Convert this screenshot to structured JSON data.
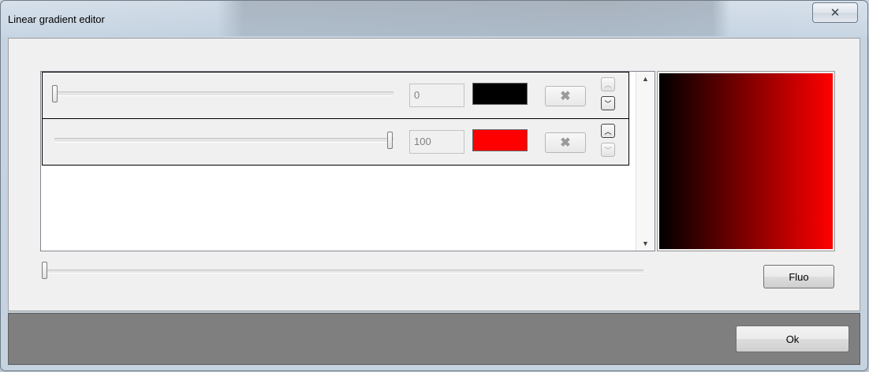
{
  "window": {
    "title": "Linear gradient editor",
    "close_icon": "close-icon"
  },
  "stops": [
    {
      "position": "0",
      "position_fraction": 0.0,
      "color": "#000000",
      "delete_icon": "delete-icon",
      "move_up_enabled": false,
      "move_down_enabled": true
    },
    {
      "position": "100",
      "position_fraction": 1.0,
      "color": "#ff0000",
      "delete_icon": "delete-icon",
      "move_up_enabled": true,
      "move_down_enabled": false
    }
  ],
  "list_scrollbar": {
    "up_icon": "scroll-up-icon",
    "down_icon": "scroll-down-icon"
  },
  "preview": {
    "gradient_start": "#000000",
    "gradient_end": "#ff0000"
  },
  "bottom_slider": {
    "value_fraction": 0.0
  },
  "buttons": {
    "fluo_label": "Fluo",
    "ok_label": "Ok"
  }
}
